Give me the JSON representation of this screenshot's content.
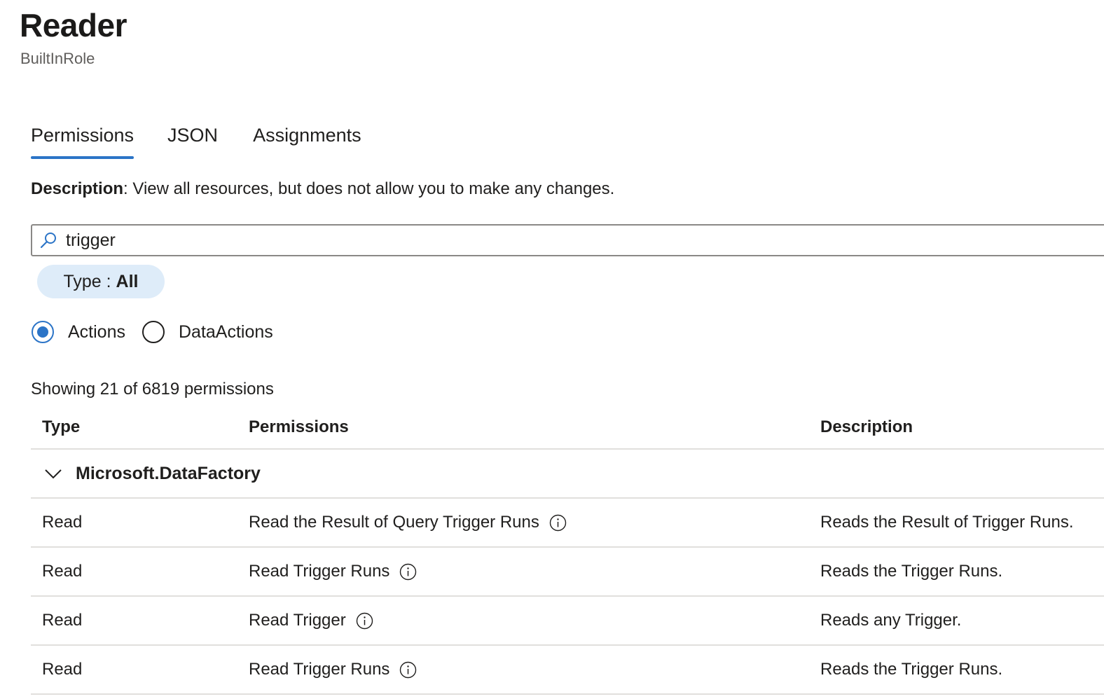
{
  "header": {
    "title": "Reader",
    "subtitle": "BuiltInRole"
  },
  "tabs": [
    {
      "label": "Permissions",
      "active": true
    },
    {
      "label": "JSON",
      "active": false
    },
    {
      "label": "Assignments",
      "active": false
    }
  ],
  "description": {
    "label": "Description",
    "separator": ":",
    "text": " View all resources, but does not allow you to make any changes."
  },
  "search": {
    "value": "trigger",
    "icon": "search-icon"
  },
  "filter": {
    "label": "Type : ",
    "value": "All"
  },
  "radios": [
    {
      "label": "Actions",
      "checked": true
    },
    {
      "label": "DataActions",
      "checked": false
    }
  ],
  "showing": "Showing 21 of 6819 permissions",
  "table": {
    "columns": {
      "type": "Type",
      "permissions": "Permissions",
      "description": "Description"
    },
    "group": {
      "label": "Microsoft.DataFactory",
      "expanded": true
    },
    "rows": [
      {
        "type": "Read",
        "permission": "Read the Result of Query Trigger Runs",
        "description": "Reads the Result of Trigger Runs."
      },
      {
        "type": "Read",
        "permission": "Read Trigger Runs",
        "description": "Reads the Trigger Runs."
      },
      {
        "type": "Read",
        "permission": "Read Trigger",
        "description": "Reads any Trigger."
      },
      {
        "type": "Read",
        "permission": "Read Trigger Runs",
        "description": "Reads the Trigger Runs."
      }
    ]
  },
  "colors": {
    "accent": "#2b74c7",
    "pill_bg": "#deecf9",
    "divider": "#e1dfdd",
    "text": "#201f1e",
    "subtle_text": "#605e5c"
  }
}
